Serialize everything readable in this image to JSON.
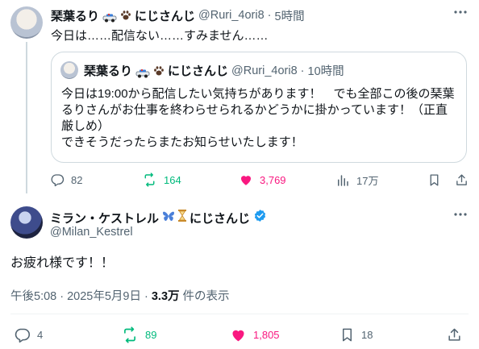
{
  "tweet1": {
    "author_name": "琹葉るり",
    "author_suffix": "にじさんじ",
    "handle": "@Ruri_4ori8",
    "time": "5時間",
    "text": "今日は……配信ない……すみません……",
    "quote": {
      "author_name": "琹葉るり",
      "author_suffix": "にじさんじ",
      "handle": "@Ruri_4ori8",
      "time": "10時間",
      "line1": "今日は19:00から配信したい気持ちがあります！　でも全部この後の琹葉",
      "line2": "るりさんがお仕事を終わらせられるかどうかに掛かっています！（正直",
      "line3": "厳しめ）",
      "line4": "できそうだったらまたお知らせいたします！"
    },
    "stats": {
      "replies": "82",
      "reposts": "164",
      "likes": "3,769",
      "views": "17万"
    }
  },
  "tweet2": {
    "author_name": "ミラン・ケストレル",
    "author_suffix": "にじさんじ",
    "handle": "@Milan_Kestrel",
    "text": "お疲れ様です！！",
    "timestamp": "午後5:08 · 2025年5月9日 ·",
    "views_count": "3.3万",
    "views_label": "件の表示",
    "stats": {
      "replies": "4",
      "reposts": "89",
      "likes": "1,805",
      "bookmarks": "18"
    }
  },
  "colors": {
    "text": "#0f1419",
    "muted": "#536471",
    "border": "#cfd9de",
    "repost_green": "#00ba7c",
    "like_pink": "#f91880",
    "verified_blue": "#1d9bf0"
  },
  "icons": {
    "more": "more-icon",
    "reply": "reply-icon",
    "repost": "repost-icon",
    "like": "heart-icon",
    "views": "views-icon",
    "bookmark": "bookmark-icon",
    "share": "share-icon",
    "verified": "verified-badge-icon"
  }
}
